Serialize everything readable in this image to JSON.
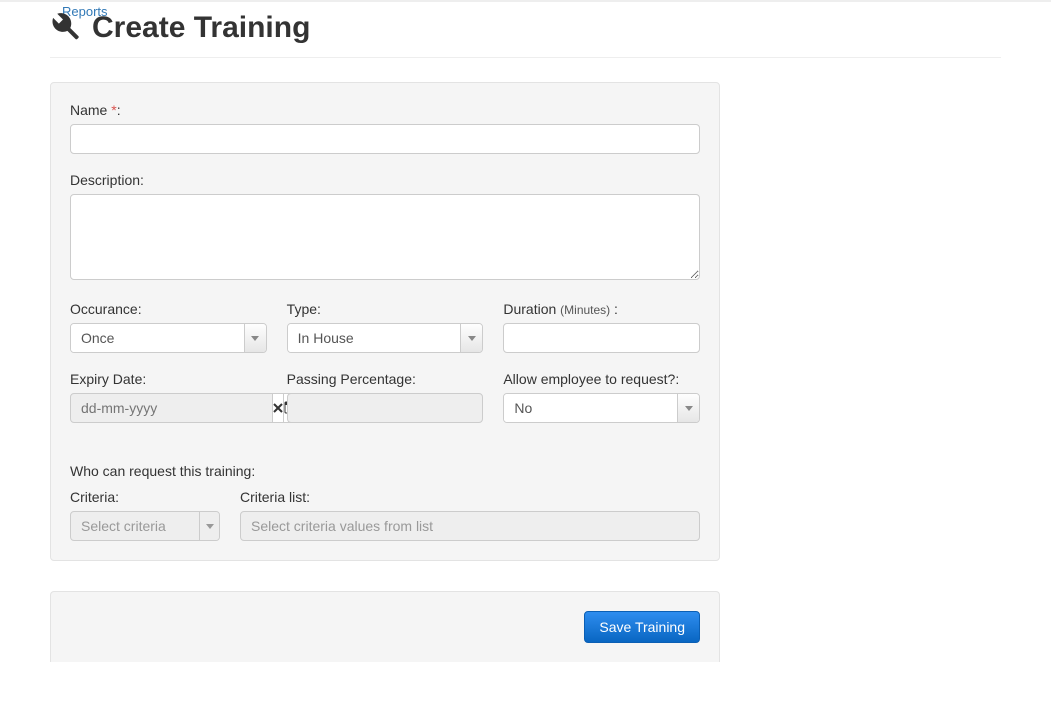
{
  "nav": {
    "reports": "Reports"
  },
  "page": {
    "title": "Create Training"
  },
  "form": {
    "name": {
      "label": "Name ",
      "required_mark": "*",
      "suffix": ":",
      "value": ""
    },
    "description": {
      "label": "Description:",
      "value": ""
    },
    "occurance": {
      "label": "Occurance:",
      "value": "Once"
    },
    "type": {
      "label": "Type:",
      "value": "In House"
    },
    "duration": {
      "label": "Duration ",
      "sublabel": "(Minutes)",
      "suffix": " :",
      "value": ""
    },
    "expiry": {
      "label": "Expiry Date:",
      "placeholder": "dd-mm-yyyy",
      "value": ""
    },
    "passing": {
      "label": "Passing Percentage:",
      "value": ""
    },
    "allow_request": {
      "label": "Allow employee to request?:",
      "value": "No"
    },
    "who_request": {
      "label": "Who can request this training:"
    },
    "criteria": {
      "label": "Criteria:",
      "placeholder": "Select criteria"
    },
    "criteria_list": {
      "label": "Criteria list:",
      "placeholder": "Select criteria values from list"
    }
  },
  "actions": {
    "save": "Save Training"
  },
  "icons": {
    "wrench": "wrench-icon",
    "clear": "clear-icon",
    "calendar": "calendar-icon",
    "chevron_down": "chevron-down-icon"
  }
}
